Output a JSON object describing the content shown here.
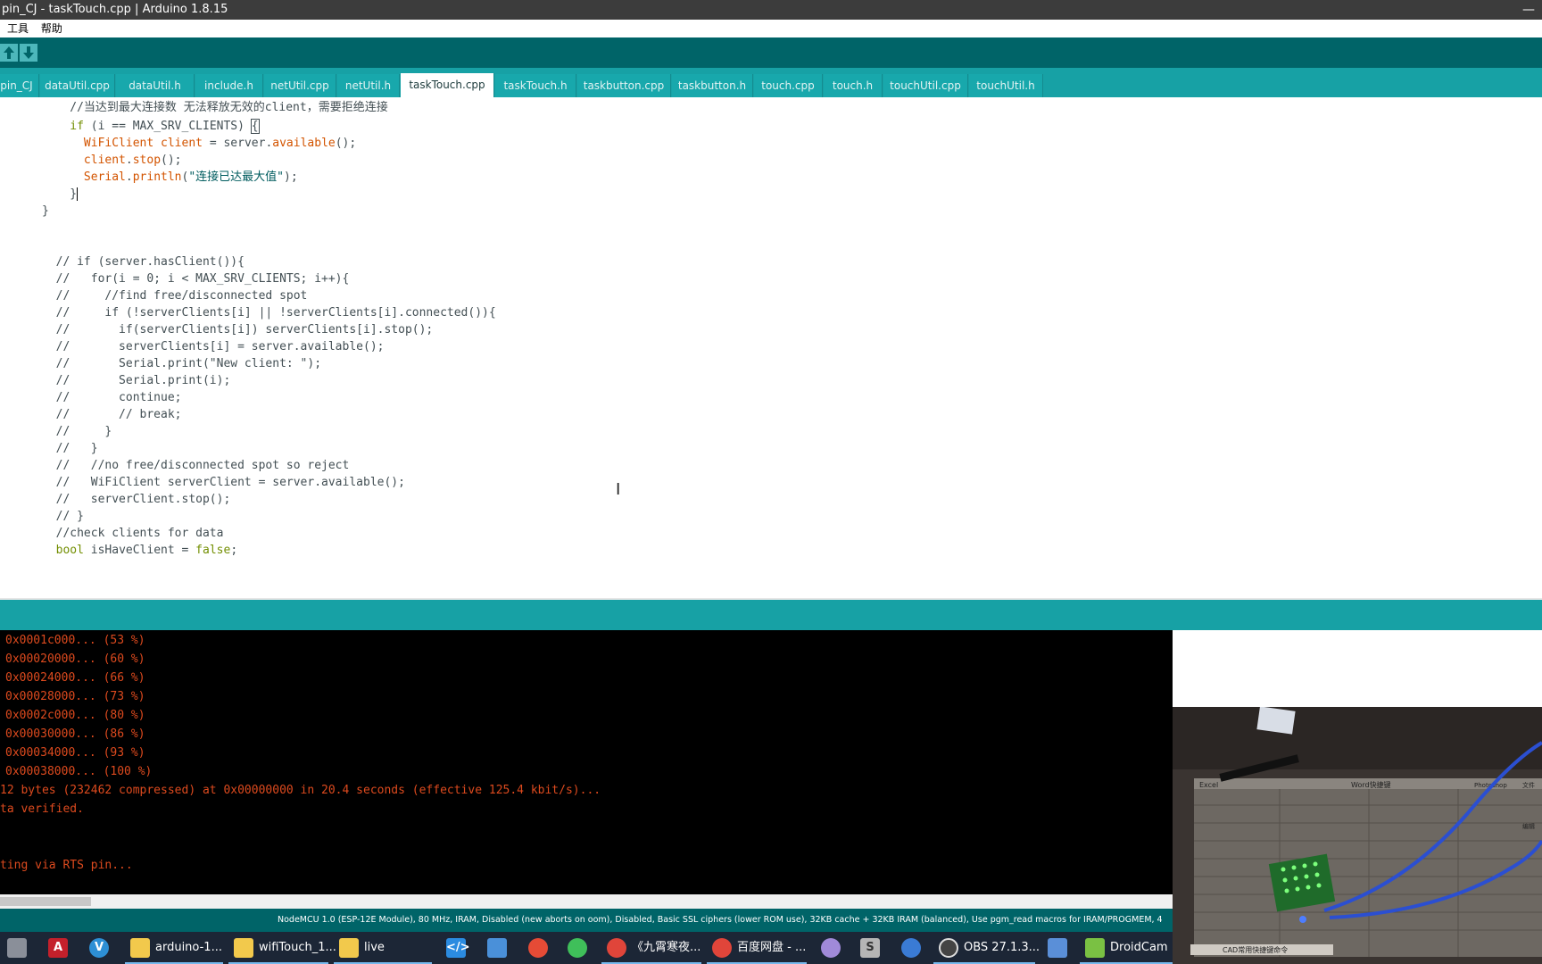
{
  "window": {
    "title": "pin_CJ - taskTouch.cpp | Arduino 1.8.15",
    "minimize_glyph": "—"
  },
  "menu": {
    "items": [
      "工具",
      "帮助"
    ]
  },
  "toolbar": {
    "upload_icon": "arrow-up-icon",
    "download_icon": "arrow-down-icon"
  },
  "tabs": [
    {
      "label": "pin_CJ",
      "active": false
    },
    {
      "label": "dataUtil.cpp",
      "active": false
    },
    {
      "label": "dataUtil.h",
      "active": false
    },
    {
      "label": "include.h",
      "active": false
    },
    {
      "label": "netUtil.cpp",
      "active": false
    },
    {
      "label": "netUtil.h",
      "active": false
    },
    {
      "label": "taskTouch.cpp",
      "active": true
    },
    {
      "label": "taskTouch.h",
      "active": false
    },
    {
      "label": "taskbutton.cpp",
      "active": false
    },
    {
      "label": "taskbutton.h",
      "active": false
    },
    {
      "label": "touch.cpp",
      "active": false
    },
    {
      "label": "touch.h",
      "active": false
    },
    {
      "label": "touchUtil.cpp",
      "active": false
    },
    {
      "label": "touchUtil.h",
      "active": false
    }
  ],
  "editor": {
    "lines": [
      "          //当达到最大连接数 无法释放无效的client，需要拒绝连接",
      "          if (i == MAX_SRV_CLIENTS) {",
      "            WiFiClient client = server.available();",
      "            client.stop();",
      "            Serial.println(\"连接已达最大值\");",
      "          }",
      "      }",
      "",
      "",
      "        // if (server.hasClient()){",
      "        //   for(i = 0; i < MAX_SRV_CLIENTS; i++){",
      "        //     //find free/disconnected spot",
      "        //     if (!serverClients[i] || !serverClients[i].connected()){",
      "        //       if(serverClients[i]) serverClients[i].stop();",
      "        //       serverClients[i] = server.available();",
      "        //       Serial.print(\"New client: \");",
      "        //       Serial.print(i);",
      "        //       continue;",
      "        //       // break;",
      "        //     }",
      "        //   }",
      "        //   //no free/disconnected spot so reject",
      "        //   WiFiClient serverClient = server.available();",
      "        //   serverClient.stop();",
      "        // }",
      "        //check clients for data",
      "        bool isHaveClient = false;"
    ]
  },
  "console": {
    "lines": [
      "0x0001c000... (53 %)",
      "0x00020000... (60 %)",
      "0x00024000... (66 %)",
      "0x00028000... (73 %)",
      "0x0002c000... (80 %)",
      "0x00030000... (86 %)",
      "0x00034000... (93 %)",
      "0x00038000... (100 %)",
      "12 bytes (232462 compressed) at 0x00000000 in 20.4 seconds (effective 125.4 kbit/s)...",
      "ta verified.",
      "",
      "",
      "ting via RTS pin..."
    ]
  },
  "board_status": "NodeMCU 1.0 (ESP-12E Module), 80 MHz, IRAM, Disabled (new aborts on oom), Disabled, Basic SSL ciphers (lower ROM use), 32KB cache + 32KB IRAM (balanced), Use pgm_read macros for IRAM/PROGMEM, 4",
  "taskbar": {
    "items": [
      {
        "label": "",
        "icon": "app-icon",
        "color": "#8a8f99"
      },
      {
        "label": "",
        "icon": "autocad-icon",
        "color": "#c4202b"
      },
      {
        "label": "",
        "icon": "app-v-icon",
        "color": "#2d8fd5"
      },
      {
        "label": "arduino-1...",
        "icon": "folder-icon",
        "color": "#f2c94c"
      },
      {
        "label": "wifiTouch_1...",
        "icon": "folder-icon",
        "color": "#f2c94c"
      },
      {
        "label": "live",
        "icon": "folder-icon",
        "color": "#f2c94c"
      },
      {
        "label": "",
        "icon": "vscode-icon",
        "color": "#2b8be0"
      },
      {
        "label": "",
        "icon": "app-window-icon",
        "color": "#4a90d9"
      },
      {
        "label": "",
        "icon": "qq-icon",
        "color": "#e54b36"
      },
      {
        "label": "",
        "icon": "wechat-icon",
        "color": "#3fbf5a"
      },
      {
        "label": "《九霄寒夜...",
        "icon": "chrome-icon",
        "color": "#e0453a"
      },
      {
        "label": "百度网盘 - ...",
        "icon": "chrome-icon",
        "color": "#e0453a"
      },
      {
        "label": "",
        "icon": "github-icon",
        "color": "#a08ad9"
      },
      {
        "label": "",
        "icon": "app-s-icon",
        "color": "#b5b5b5"
      },
      {
        "label": "",
        "icon": "location-icon",
        "color": "#3a7bd5"
      },
      {
        "label": "OBS 27.1.3...",
        "icon": "obs-icon",
        "color": "#444444"
      },
      {
        "label": "",
        "icon": "remote-desktop-icon",
        "color": "#5a8fd8"
      },
      {
        "label": "DroidCam ...",
        "icon": "droidcam-icon",
        "color": "#7ac143"
      }
    ]
  },
  "webcam": {
    "sheet_header": "Word快捷键",
    "card_left": "Excel",
    "card_right": "Photoshop",
    "card_far": "文件",
    "bottom_label": "CAD常用快捷键命令",
    "side_label": "编辑"
  }
}
